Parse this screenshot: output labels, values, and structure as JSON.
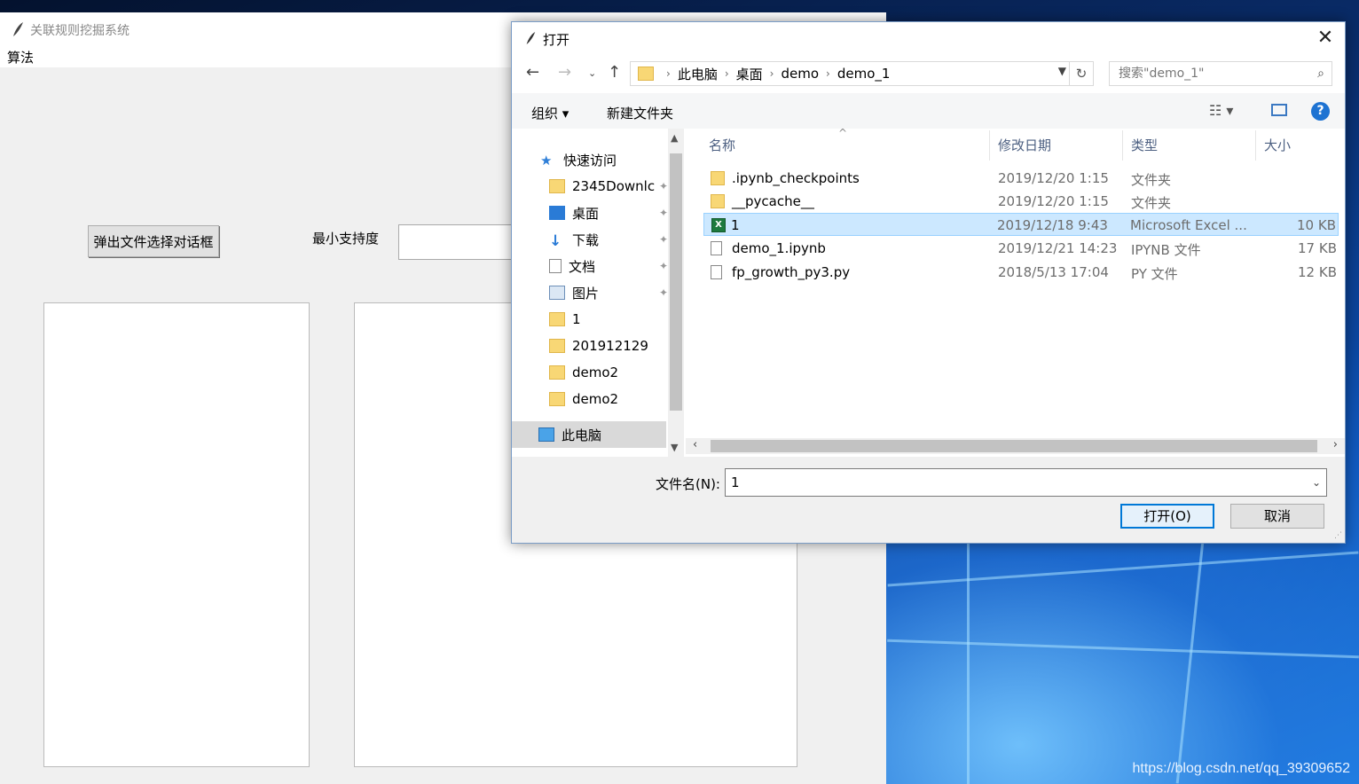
{
  "main_window": {
    "title": "关联规则挖掘系统",
    "menu": "算法",
    "select_button": "弹出文件选择对话框",
    "min_support_label": "最小支持度"
  },
  "dialog": {
    "title": "打开",
    "close_glyph": "✕",
    "breadcrumb": [
      "此电脑",
      "桌面",
      "demo",
      "demo_1"
    ],
    "search_placeholder": "搜索\"demo_1\"",
    "toolbar": {
      "organize": "组织 ▾",
      "new_folder": "新建文件夹"
    },
    "sidebar": {
      "quick_access": "快速访问",
      "items": [
        "2345Downlc",
        "桌面",
        "下载",
        "文档",
        "图片",
        "1",
        "201912129",
        "demo2",
        "demo2"
      ],
      "this_pc": "此电脑"
    },
    "columns": {
      "name": "名称",
      "date": "修改日期",
      "type": "类型",
      "size": "大小"
    },
    "files": [
      {
        "name": ".ipynb_checkpoints",
        "date": "2019/12/20 1:15",
        "type": "文件夹",
        "size": ""
      },
      {
        "name": "__pycache__",
        "date": "2019/12/20 1:15",
        "type": "文件夹",
        "size": ""
      },
      {
        "name": "1",
        "date": "2019/12/18 9:43",
        "type": "Microsoft Excel ...",
        "size": "10 KB"
      },
      {
        "name": "demo_1.ipynb",
        "date": "2019/12/21 14:23",
        "type": "IPYNB 文件",
        "size": "17 KB"
      },
      {
        "name": "fp_growth_py3.py",
        "date": "2018/5/13 17:04",
        "type": "PY 文件",
        "size": "12 KB"
      }
    ],
    "filename_label": "文件名(N):",
    "filename_value": "1",
    "open_button": "打开(O)",
    "cancel_button": "取消"
  },
  "watermark": "https://blog.csdn.net/qq_39309652",
  "colors": {
    "accent": "#0078d7",
    "selection": "#cce8ff",
    "folder": "#f8d775"
  }
}
